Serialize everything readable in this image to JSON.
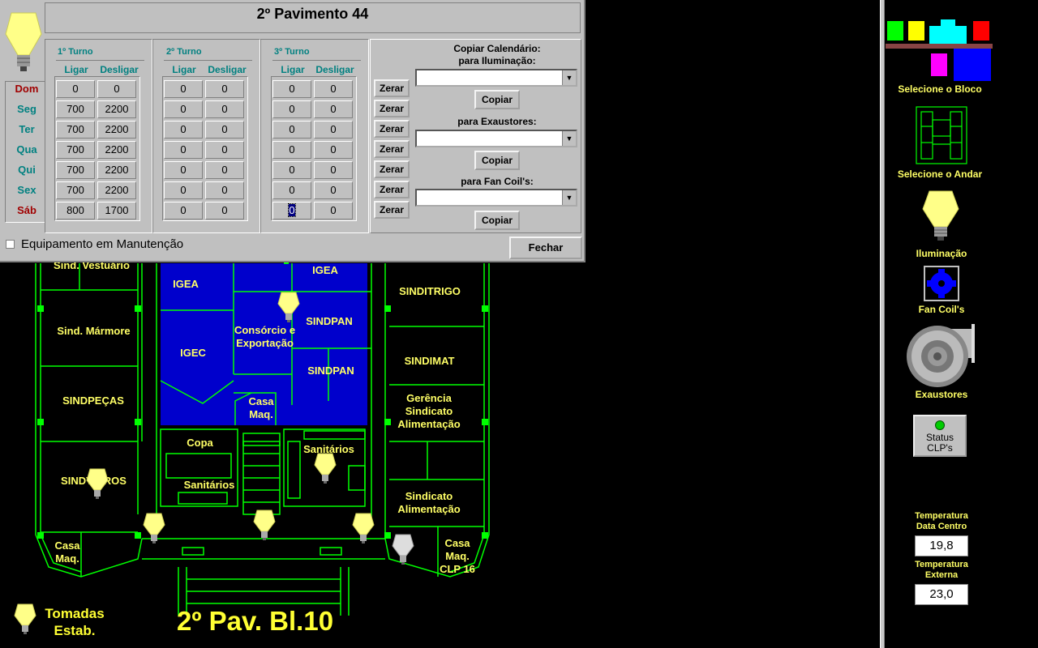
{
  "dialog": {
    "title": "2º Pavimento 44",
    "turnos": [
      {
        "label": "1º Turno",
        "ligar": "Ligar",
        "desligar": "Desligar",
        "values": [
          [
            "0",
            "0"
          ],
          [
            "700",
            "2200"
          ],
          [
            "700",
            "2200"
          ],
          [
            "700",
            "2200"
          ],
          [
            "700",
            "2200"
          ],
          [
            "700",
            "2200"
          ],
          [
            "800",
            "1700"
          ]
        ]
      },
      {
        "label": "2º Turno",
        "ligar": "Ligar",
        "desligar": "Desligar",
        "values": [
          [
            "0",
            "0"
          ],
          [
            "0",
            "0"
          ],
          [
            "0",
            "0"
          ],
          [
            "0",
            "0"
          ],
          [
            "0",
            "0"
          ],
          [
            "0",
            "0"
          ],
          [
            "0",
            "0"
          ]
        ]
      },
      {
        "label": "3º Turno",
        "ligar": "Ligar",
        "desligar": "Desligar",
        "values": [
          [
            "0",
            "0"
          ],
          [
            "0",
            "0"
          ],
          [
            "0",
            "0"
          ],
          [
            "0",
            "0"
          ],
          [
            "0",
            "0"
          ],
          [
            "0",
            "0"
          ],
          [
            "0",
            "0"
          ]
        ]
      }
    ],
    "days": [
      "Dom",
      "Seg",
      "Ter",
      "Qua",
      "Qui",
      "Sex",
      "Sáb"
    ],
    "zerar_label": "Zerar",
    "copy_title_1": "Copiar Calendário:",
    "copy_title_2": "para Iluminação:",
    "copy_exaustores": "para Exaustores:",
    "copy_fancoils": "para Fan Coil's:",
    "copiar_label": "Copiar",
    "maintenance_label": "Equipamento em Manutenção",
    "fechar_label": "Fechar"
  },
  "plan": {
    "rooms": {
      "vestiario": "Sind. Vestuário",
      "igea1": "IGEA",
      "igea2": "IGEA",
      "sinditrigo": "SINDITRIGO",
      "marmore": "Sind. Mármore",
      "consorcio": "Consórcio e Exportação",
      "sindpan1": "SINDPAN",
      "igec": "IGEC",
      "sindimat": "SINDIMAT",
      "sindpan2": "SINDPAN",
      "sindpecas": "SINDPEÇAS",
      "casamaq1": "Casa Maq.",
      "gerencia": "Gerência Sindicato Alimentação",
      "copa": "Copa",
      "sanitarios1": "Sanitários",
      "sanitarios2": "Sanitários",
      "sindvidros": "SINDVIDROS",
      "sind_alim": "Sindicato Alimentação",
      "casamaq2": "Casa Maq.",
      "casamaq3": "Casa Maq. CLP 16"
    },
    "floor_title": "2º Pav. Bl.10",
    "tomadas": "Tomadas Estab."
  },
  "side": {
    "bloco": "Selecione o Bloco",
    "andar": "Selecione o Andar",
    "iluminacao": "Iluminação",
    "fancoils": "Fan Coil's",
    "exaustores": "Exaustores",
    "status_1": "Status",
    "status_2": "CLP's",
    "temp_dc_1": "Temperatura",
    "temp_dc_2": "Data Centro",
    "temp_dc_value": "19,8",
    "temp_ext_1": "Temperatura",
    "temp_ext_2": "Externa",
    "temp_ext_value": "23,0"
  },
  "colors": {
    "wall": "#00ff00",
    "office": "#0000cc",
    "label": "#ffff66",
    "bulb_on": "#ffff66",
    "bulb_off": "#dddddd"
  }
}
